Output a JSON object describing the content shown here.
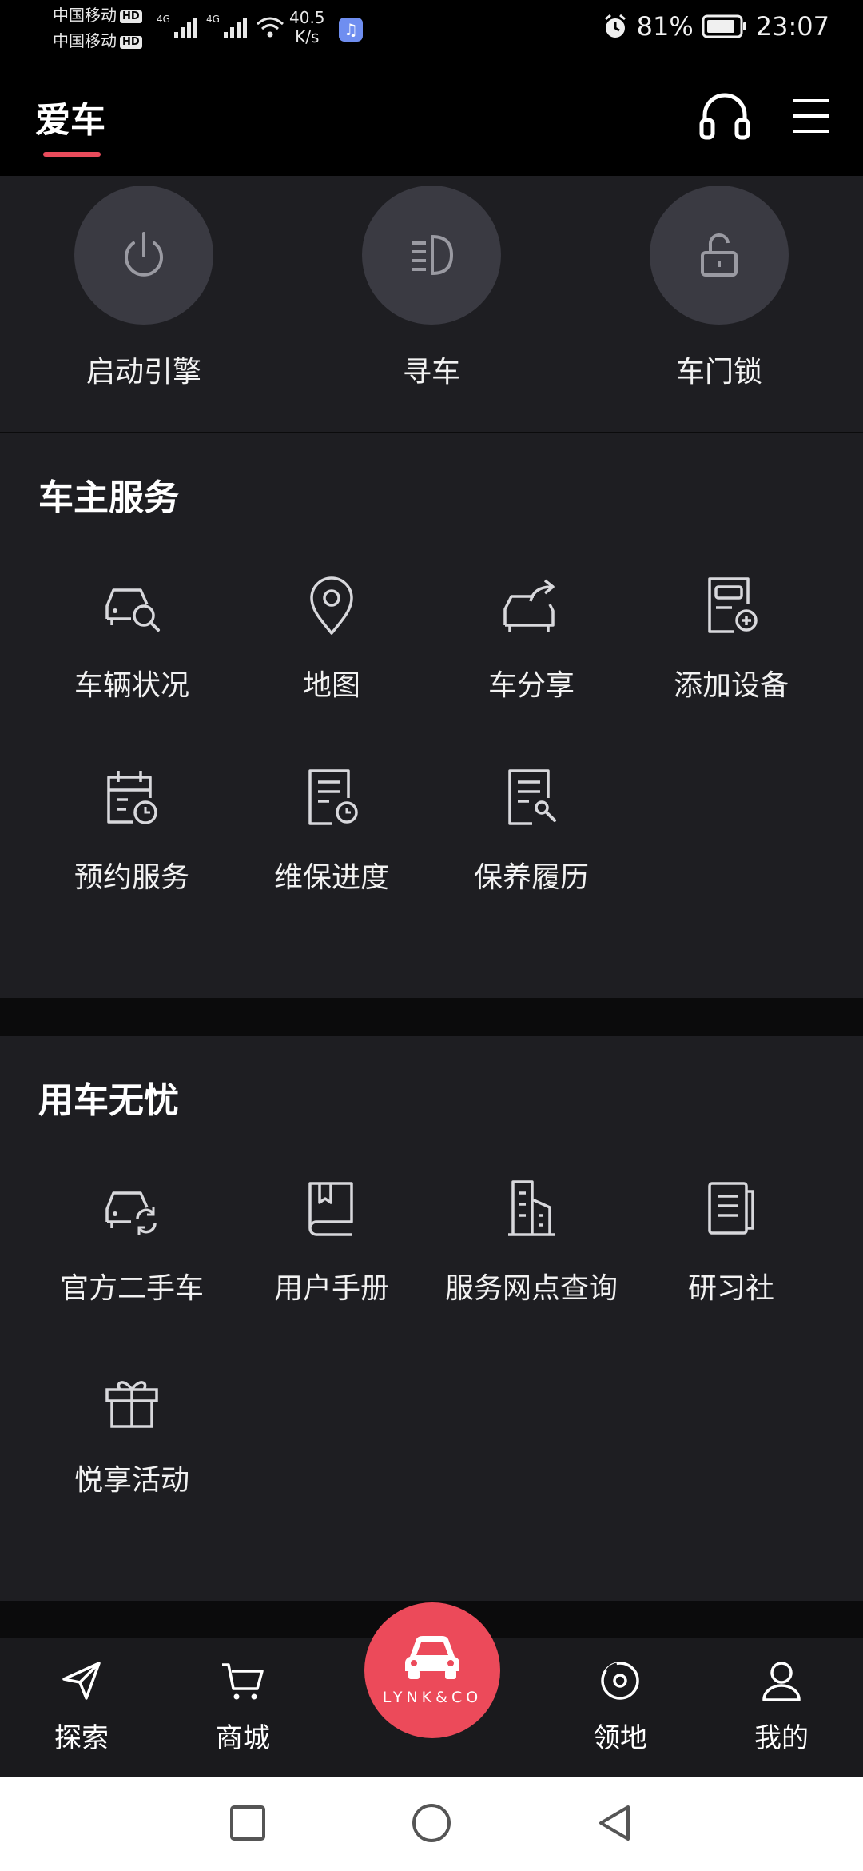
{
  "status_bar": {
    "carrier1": "中国移动",
    "carrier2": "中国移动",
    "hd": "HD",
    "net_type1": "4G",
    "net_type2": "4G",
    "net_speed_value": "40.5",
    "net_speed_unit": "K/s",
    "battery": "81%",
    "time": "23:07"
  },
  "header": {
    "active_tab": "爱车"
  },
  "quick_actions": [
    {
      "label": "启动引擎",
      "icon": "power-icon"
    },
    {
      "label": "寻车",
      "icon": "headlight-icon"
    },
    {
      "label": "车门锁",
      "icon": "unlock-icon"
    }
  ],
  "owner_services": {
    "title": "车主服务",
    "items": [
      {
        "label": "车辆状况",
        "icon": "car-search-icon"
      },
      {
        "label": "地图",
        "icon": "map-pin-icon"
      },
      {
        "label": "车分享",
        "icon": "car-share-icon"
      },
      {
        "label": "添加设备",
        "icon": "add-device-icon"
      },
      {
        "label": "预约服务",
        "icon": "calendar-clock-icon"
      },
      {
        "label": "维保进度",
        "icon": "document-clock-icon"
      },
      {
        "label": "保养履历",
        "icon": "document-wrench-icon"
      }
    ]
  },
  "carefree": {
    "title": "用车无忧",
    "items": [
      {
        "label": "官方二手车",
        "icon": "car-refresh-icon"
      },
      {
        "label": "用户手册",
        "icon": "book-icon"
      },
      {
        "label": "服务网点查询",
        "icon": "building-icon"
      },
      {
        "label": "研习社",
        "icon": "notes-icon"
      },
      {
        "label": "悦享活动",
        "icon": "gift-icon"
      }
    ]
  },
  "bottom_nav": {
    "items": [
      {
        "label": "探索",
        "icon": "send-icon"
      },
      {
        "label": "商城",
        "icon": "cart-icon"
      },
      {
        "label": "领地",
        "icon": "target-icon"
      },
      {
        "label": "我的",
        "icon": "user-icon"
      }
    ],
    "center_brand": "LYNK&CO"
  },
  "colors": {
    "accent": "#ec4a5a",
    "background": "#0b0b0c",
    "card": "#1e1e22",
    "icon_circle": "#3a3a42"
  }
}
